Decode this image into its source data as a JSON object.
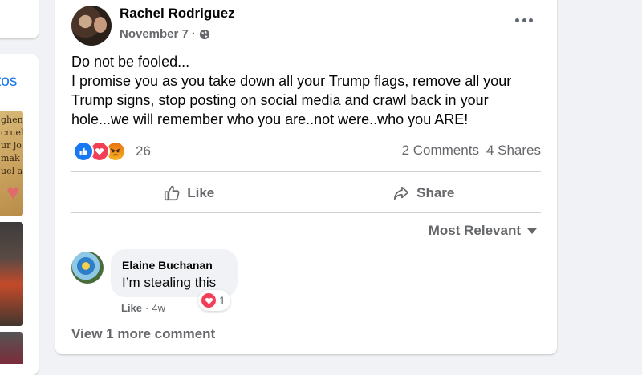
{
  "left_column": {
    "photos_link": "tos",
    "thumb1_lines": [
      "ghen",
      "cruel",
      "ur jo",
      "mak",
      "uel a"
    ]
  },
  "post": {
    "author": "Rachel Rodriguez",
    "date": "November 7",
    "separator": "·",
    "privacy_icon": "globe-icon",
    "text": "Do not be fooled...\nI promise you as you take down all your Trump flags, remove all your Trump signs, stop posting on social media and crawl back in your hole...we will remember who you are..not were..who you ARE!",
    "reactions": {
      "icons": [
        "like-icon",
        "love-icon",
        "angry-icon"
      ],
      "count": "26"
    },
    "comments_count": "2 Comments",
    "shares_count": "4 Shares",
    "actions": {
      "like_label": "Like",
      "share_label": "Share"
    },
    "sort_label": "Most Relevant"
  },
  "comments": [
    {
      "author": "Elaine Buchanan",
      "text": "I’m stealing this",
      "like_label": "Like",
      "time": "4w",
      "reaction_count": "1"
    }
  ],
  "view_more_label": "View 1 more comment",
  "colors": {
    "background": "#f0f2f5",
    "card": "#ffffff",
    "secondary_text": "#65676b",
    "link": "#1877f2",
    "love": "#f33e58"
  }
}
